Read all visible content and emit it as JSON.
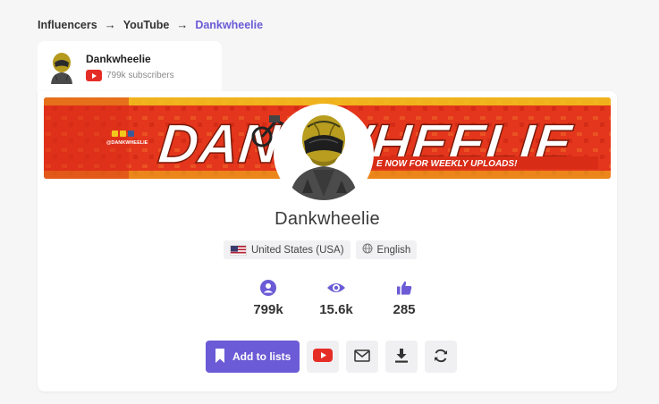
{
  "breadcrumb": {
    "items": [
      "Influencers",
      "YouTube",
      "Dankwheelie"
    ],
    "separator": "→"
  },
  "mini_card": {
    "name": "Dankwheelie",
    "subscribers": "799k subscribers",
    "platform_icon": "youtube-icon"
  },
  "banner": {
    "title": "DANKWHEELIE",
    "tagline": "E NOW FOR WEEKLY UPLOADS!",
    "handle": "@DANKWHEELIE"
  },
  "profile": {
    "name": "Dankwheelie",
    "country": "United States (USA)",
    "language": "English"
  },
  "stats": [
    {
      "icon": "user-icon",
      "value": "799k"
    },
    {
      "icon": "eye-icon",
      "value": "15.6k"
    },
    {
      "icon": "thumbs-up-icon",
      "value": "285"
    }
  ],
  "actions": {
    "add_to_lists": "Add to lists",
    "icons": [
      "youtube-icon",
      "mail-icon",
      "download-icon",
      "refresh-icon"
    ]
  },
  "colors": {
    "accent": "#6b5bd6",
    "youtube_red": "#e52d27",
    "banner_red": "#e63a1e",
    "banner_yellow": "#f2c81c"
  }
}
